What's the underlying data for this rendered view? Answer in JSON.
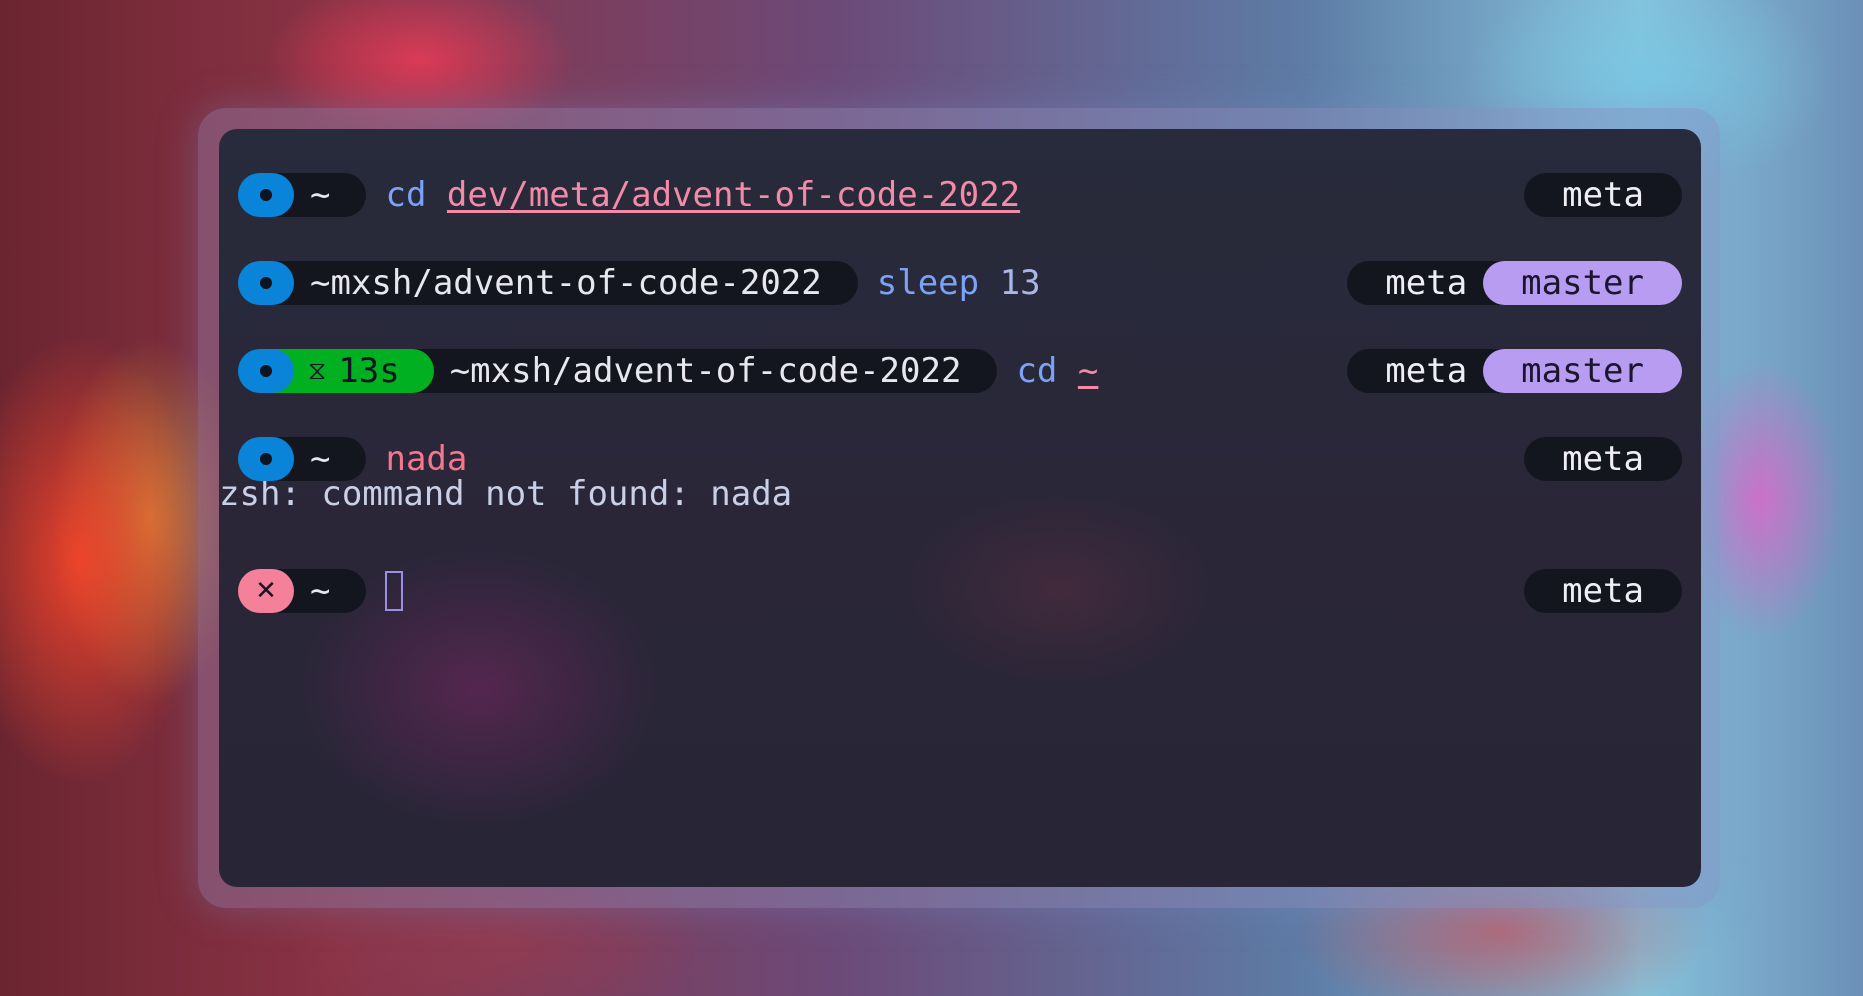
{
  "terminal": {
    "lines": [
      {
        "status": "ok",
        "path": "~",
        "command": "cd",
        "argument": "dev/meta/advent-of-code-2022",
        "user": "meta"
      },
      {
        "status": "ok",
        "path": "~mxsh/advent-of-code-2022",
        "command": "sleep",
        "argument": "13",
        "user": "meta",
        "branch": "master"
      },
      {
        "status": "ok",
        "duration": "13s",
        "path": "~mxsh/advent-of-code-2022",
        "command": "cd",
        "argument": "~",
        "user": "meta",
        "branch": "master"
      },
      {
        "status": "ok",
        "path": "~",
        "command": "nada",
        "user": "meta"
      },
      {
        "status": "error",
        "path": "~",
        "user": "meta"
      }
    ],
    "error_output": "zsh: command not found: nada",
    "icons": {
      "ok": "dot-icon",
      "error": "x-icon",
      "timer": "hourglass-icon"
    },
    "colors": {
      "ok_pill": "#0a84d8",
      "error_pill": "#f4809a",
      "timer_segment": "#00b020",
      "branch_segment": "#b79cf2",
      "command": "#7aa2f7",
      "unknown_command": "#f7768e"
    }
  }
}
